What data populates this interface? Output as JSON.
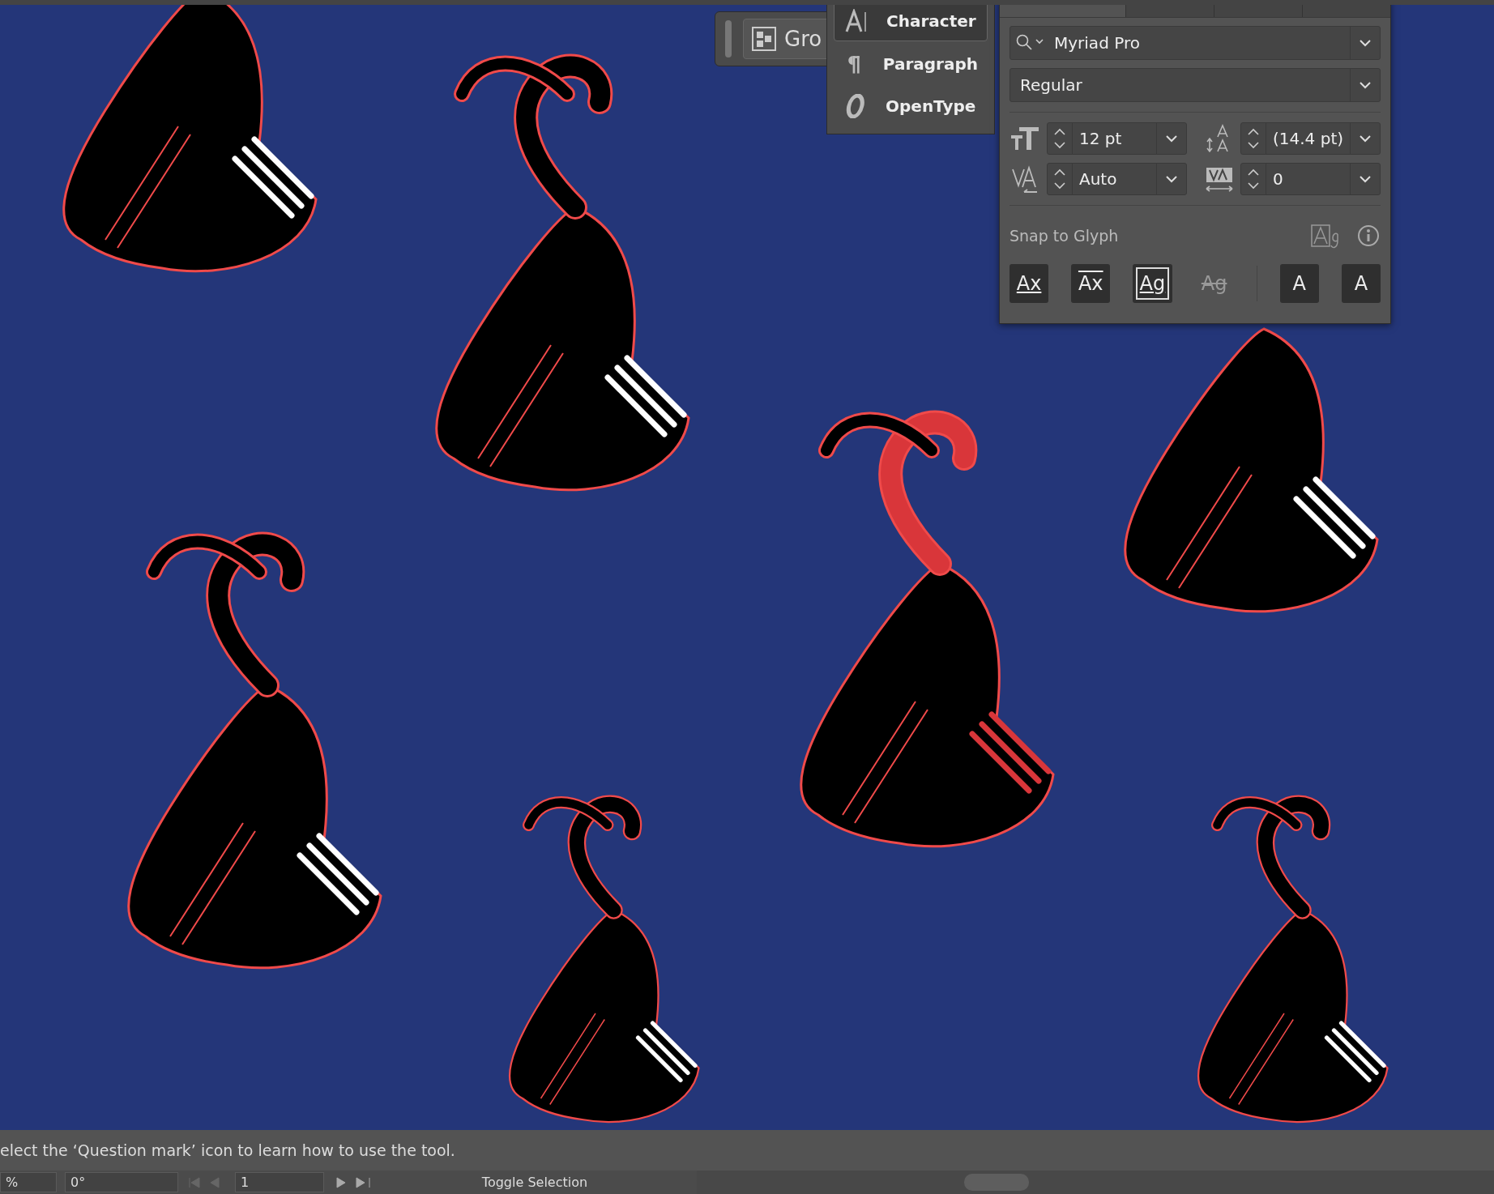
{
  "control_bar": {
    "group_label": "Gro"
  },
  "panel_menu": [
    {
      "label": "Character",
      "kind": "character",
      "selected": true
    },
    {
      "label": "Paragraph",
      "kind": "paragraph",
      "selected": false
    },
    {
      "label": "OpenType",
      "kind": "opentype",
      "selected": false
    }
  ],
  "character_panel": {
    "font_family": "Myriad Pro",
    "font_style": "Regular",
    "font_size": "12 pt",
    "leading": "(14.4 pt)",
    "kerning": "Auto",
    "tracking": "0",
    "snap_label": "Snap to Glyph",
    "snap_buttons": [
      {
        "glyph": "Ax",
        "kind": "baseline",
        "on": true
      },
      {
        "glyph": "Ax",
        "kind": "xheight",
        "on": true
      },
      {
        "glyph": "Ag",
        "kind": "glyph-bounds",
        "on": true
      },
      {
        "glyph": "Ag",
        "kind": "proximity",
        "on": false
      },
      {
        "glyph": "A",
        "kind": "angular",
        "on": true
      },
      {
        "glyph": "A",
        "kind": "anchor",
        "on": true
      }
    ]
  },
  "status_bar": {
    "message": "elect the ‘Question mark’ icon to learn how to use the tool.",
    "zoom": "%",
    "rotation": "0°",
    "artboard": "1",
    "toggle": "Toggle Selection"
  }
}
